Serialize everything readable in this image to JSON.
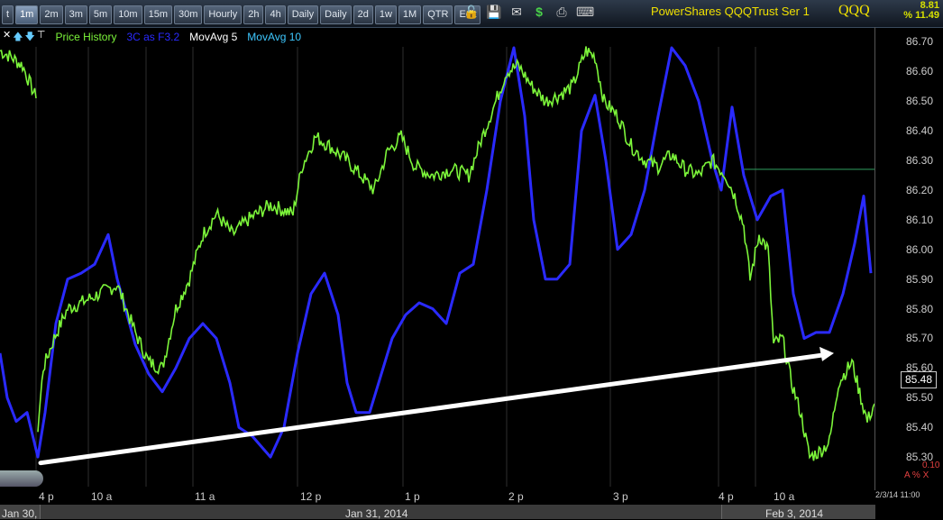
{
  "toolbar": {
    "timeframes": [
      "t",
      "1m",
      "2m",
      "3m",
      "5m",
      "10m",
      "15m",
      "30m",
      "Hourly",
      "2h",
      "4h",
      "Daily",
      "Daily",
      "2d",
      "1w",
      "1M",
      "QTR",
      "Edit"
    ],
    "active_index": 1,
    "icons": [
      "lock-icon",
      "save-icon",
      "mail-icon",
      "dollar-icon",
      "print-icon",
      "keyboard-icon"
    ],
    "instrument_name": "PowerShares QQQTrust Ser 1",
    "symbol": "QQQ",
    "change_abs": "8.81",
    "change_pct": "% 11.49"
  },
  "legend": {
    "items": [
      {
        "label": "Price History",
        "color": "#7cf53a"
      },
      {
        "label": "3C as F3.2",
        "color": "#2a2aff"
      },
      {
        "label": "MovAvg 5",
        "color": "#ffffff"
      },
      {
        "label": "MovAvg 10",
        "color": "#3ec8ff"
      }
    ]
  },
  "axis": {
    "last_price": "85.48",
    "lower_value": "0.10",
    "lower_icons": "A % X",
    "corner_date": "2/3/14 11:00",
    "dates": [
      "Jan 30,",
      "Jan 31, 2014",
      "Feb 3, 2014"
    ]
  },
  "chart_data": {
    "type": "line",
    "ylim": [
      85.2,
      86.75
    ],
    "y_ticks": [
      "86.70",
      "86.60",
      "86.50",
      "86.40",
      "86.30",
      "86.20",
      "86.10",
      "86.00",
      "85.90",
      "85.80",
      "85.70",
      "85.60",
      "85.50",
      "85.40",
      "85.30"
    ],
    "x_ticks": [
      "4 p",
      "10 a",
      "11 a",
      "12 p",
      "1 p",
      "2 p",
      "3 p",
      "4 p",
      "10 a"
    ],
    "horizontal_reference": 86.27,
    "series": [
      {
        "name": "Price History",
        "color": "#7cf53a",
        "values": [
          [
            0,
            86.67
          ],
          [
            12,
            86.65
          ],
          [
            25,
            86.62
          ],
          [
            40,
            86.51
          ],
          [
            42,
            85.4
          ],
          [
            48,
            85.6
          ],
          [
            60,
            85.7
          ],
          [
            75,
            85.8
          ],
          [
            90,
            85.82
          ],
          [
            110,
            85.85
          ],
          [
            130,
            85.88
          ],
          [
            150,
            85.72
          ],
          [
            165,
            85.62
          ],
          [
            180,
            85.6
          ],
          [
            195,
            85.8
          ],
          [
            210,
            85.9
          ],
          [
            225,
            86.05
          ],
          [
            240,
            86.12
          ],
          [
            258,
            86.05
          ],
          [
            275,
            86.1
          ],
          [
            300,
            86.15
          ],
          [
            325,
            86.12
          ],
          [
            335,
            86.28
          ],
          [
            350,
            86.38
          ],
          [
            365,
            86.35
          ],
          [
            385,
            86.3
          ],
          [
            400,
            86.25
          ],
          [
            415,
            86.2
          ],
          [
            430,
            86.33
          ],
          [
            445,
            86.38
          ],
          [
            460,
            86.28
          ],
          [
            480,
            86.25
          ],
          [
            500,
            86.27
          ],
          [
            520,
            86.25
          ],
          [
            535,
            86.38
          ],
          [
            550,
            86.5
          ],
          [
            562,
            86.6
          ],
          [
            575,
            86.62
          ],
          [
            590,
            86.55
          ],
          [
            605,
            86.5
          ],
          [
            620,
            86.52
          ],
          [
            635,
            86.55
          ],
          [
            650,
            86.67
          ],
          [
            660,
            86.65
          ],
          [
            670,
            86.5
          ],
          [
            685,
            86.45
          ],
          [
            700,
            86.35
          ],
          [
            715,
            86.3
          ],
          [
            730,
            86.28
          ],
          [
            745,
            86.32
          ],
          [
            760,
            86.27
          ],
          [
            775,
            86.25
          ],
          [
            790,
            86.3
          ],
          [
            805,
            86.25
          ],
          [
            815,
            86.18
          ],
          [
            825,
            86.08
          ],
          [
            832,
            85.9
          ],
          [
            842,
            86.05
          ],
          [
            852,
            86.0
          ],
          [
            858,
            85.68
          ],
          [
            868,
            85.7
          ],
          [
            878,
            85.55
          ],
          [
            888,
            85.45
          ],
          [
            898,
            85.3
          ],
          [
            910,
            85.32
          ],
          [
            920,
            85.35
          ],
          [
            930,
            85.55
          ],
          [
            945,
            85.62
          ],
          [
            955,
            85.5
          ],
          [
            962,
            85.42
          ],
          [
            970,
            85.48
          ]
        ]
      },
      {
        "name": "3C as F3.2",
        "color": "#2a2aff",
        "values": [
          [
            0,
            85.65
          ],
          [
            8,
            85.5
          ],
          [
            18,
            85.42
          ],
          [
            30,
            85.45
          ],
          [
            42,
            85.3
          ],
          [
            50,
            85.45
          ],
          [
            62,
            85.75
          ],
          [
            75,
            85.9
          ],
          [
            90,
            85.92
          ],
          [
            105,
            85.95
          ],
          [
            120,
            86.05
          ],
          [
            130,
            85.9
          ],
          [
            150,
            85.68
          ],
          [
            165,
            85.58
          ],
          [
            180,
            85.52
          ],
          [
            195,
            85.6
          ],
          [
            210,
            85.7
          ],
          [
            225,
            85.75
          ],
          [
            240,
            85.7
          ],
          [
            255,
            85.55
          ],
          [
            265,
            85.4
          ],
          [
            280,
            85.37
          ],
          [
            300,
            85.3
          ],
          [
            315,
            85.4
          ],
          [
            330,
            85.65
          ],
          [
            345,
            85.85
          ],
          [
            360,
            85.92
          ],
          [
            375,
            85.78
          ],
          [
            385,
            85.55
          ],
          [
            395,
            85.45
          ],
          [
            410,
            85.45
          ],
          [
            420,
            85.55
          ],
          [
            435,
            85.7
          ],
          [
            450,
            85.78
          ],
          [
            465,
            85.82
          ],
          [
            480,
            85.8
          ],
          [
            495,
            85.75
          ],
          [
            510,
            85.92
          ],
          [
            525,
            85.95
          ],
          [
            540,
            86.2
          ],
          [
            555,
            86.5
          ],
          [
            570,
            86.68
          ],
          [
            582,
            86.45
          ],
          [
            592,
            86.1
          ],
          [
            605,
            85.9
          ],
          [
            618,
            85.9
          ],
          [
            632,
            85.95
          ],
          [
            645,
            86.4
          ],
          [
            660,
            86.52
          ],
          [
            672,
            86.3
          ],
          [
            685,
            86.0
          ],
          [
            700,
            86.05
          ],
          [
            715,
            86.2
          ],
          [
            730,
            86.45
          ],
          [
            745,
            86.68
          ],
          [
            760,
            86.62
          ],
          [
            775,
            86.5
          ],
          [
            790,
            86.3
          ],
          [
            800,
            86.2
          ],
          [
            812,
            86.48
          ],
          [
            825,
            86.25
          ],
          [
            840,
            86.1
          ],
          [
            855,
            86.18
          ],
          [
            868,
            86.2
          ],
          [
            880,
            85.85
          ],
          [
            892,
            85.7
          ],
          [
            905,
            85.72
          ],
          [
            920,
            85.72
          ],
          [
            935,
            85.85
          ],
          [
            948,
            86.02
          ],
          [
            958,
            86.18
          ],
          [
            966,
            85.92
          ]
        ]
      },
      {
        "name": "Trend arrow",
        "color": "#ffffff",
        "values": [
          [
            45,
            85.28
          ],
          [
            925,
            85.65
          ]
        ]
      }
    ]
  }
}
